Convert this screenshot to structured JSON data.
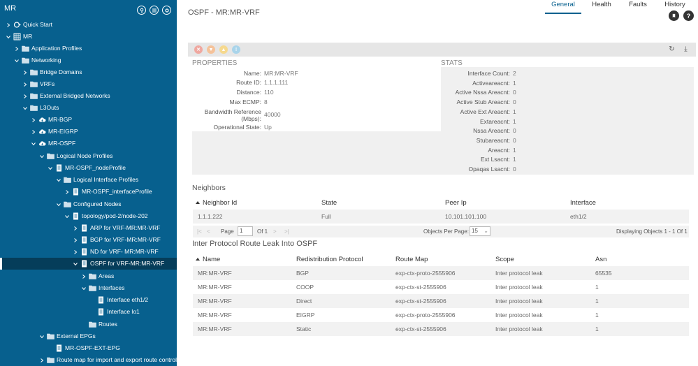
{
  "sidebar": {
    "title": "MR",
    "header_icons": [
      "map-pin-icon",
      "list-icon",
      "settings-icon"
    ],
    "tree": [
      {
        "label": "Quick Start",
        "icon": "quickstart-icon",
        "level": 0,
        "chev": "right"
      },
      {
        "label": "MR",
        "icon": "tenant-icon",
        "level": 0,
        "chev": "down"
      },
      {
        "label": "Application Profiles",
        "icon": "folder-icon",
        "level": 1,
        "chev": "right"
      },
      {
        "label": "Networking",
        "icon": "folder-icon",
        "level": 1,
        "chev": "down"
      },
      {
        "label": "Bridge Domains",
        "icon": "folder-icon",
        "level": 2,
        "chev": "right"
      },
      {
        "label": "VRFs",
        "icon": "folder-icon",
        "level": 2,
        "chev": "right"
      },
      {
        "label": "External Bridged Networks",
        "icon": "folder-icon",
        "level": 2,
        "chev": "right"
      },
      {
        "label": "L3Outs",
        "icon": "folder-icon",
        "level": 2,
        "chev": "down"
      },
      {
        "label": "MR-BGP",
        "icon": "cloud-icon",
        "level": 3,
        "chev": "right"
      },
      {
        "label": "MR-EIGRP",
        "icon": "cloud-icon",
        "level": 3,
        "chev": "right"
      },
      {
        "label": "MR-OSPF",
        "icon": "cloud-icon",
        "level": 3,
        "chev": "down"
      },
      {
        "label": "Logical Node Profiles",
        "icon": "folder-icon",
        "level": 4,
        "chev": "down"
      },
      {
        "label": "MR-OSPF_nodeProfile",
        "icon": "doc-icon",
        "level": 5,
        "chev": "down"
      },
      {
        "label": "Logical Interface Profiles",
        "icon": "folder-icon",
        "level": 6,
        "chev": "down"
      },
      {
        "label": "MR-OSPF_interfaceProfile",
        "icon": "doc-icon",
        "level": 7,
        "chev": "right"
      },
      {
        "label": "Configured Nodes",
        "icon": "folder-icon",
        "level": 6,
        "chev": "down"
      },
      {
        "label": "topology/pod-2/node-202",
        "icon": "doc-icon",
        "level": 7,
        "chev": "down"
      },
      {
        "label": "ARP for VRF-MR:MR-VRF",
        "icon": "doc-icon",
        "level": 8,
        "chev": "right"
      },
      {
        "label": "BGP for VRF-MR:MR-VRF",
        "icon": "doc-icon",
        "level": 8,
        "chev": "right"
      },
      {
        "label": "ND for VRF- MR:MR-VRF",
        "icon": "doc-icon",
        "level": 8,
        "chev": "right"
      },
      {
        "label": "OSPF for VRF-MR:MR-VRF",
        "icon": "doc-icon",
        "level": 8,
        "chev": "down",
        "selected": true
      },
      {
        "label": "Areas",
        "icon": "folder-icon",
        "level": 9,
        "chev": "right"
      },
      {
        "label": "Interfaces",
        "icon": "folder-icon",
        "level": 9,
        "chev": "down"
      },
      {
        "label": "Interface eth1/2",
        "icon": "doc-icon",
        "level": 10,
        "chev": ""
      },
      {
        "label": "Interface lo1",
        "icon": "doc-icon",
        "level": 10,
        "chev": ""
      },
      {
        "label": "Routes",
        "icon": "folder-icon",
        "level": 9,
        "chev": ""
      },
      {
        "label": "External EPGs",
        "icon": "folder-icon",
        "level": 4,
        "chev": "down"
      },
      {
        "label": "MR-OSPF-EXT-EPG",
        "icon": "doc-icon",
        "level": 5,
        "chev": ""
      },
      {
        "label": "Route map for import and export route control",
        "icon": "folder-icon",
        "level": 4,
        "chev": "right"
      }
    ]
  },
  "header": {
    "title": "OSPF - MR:MR-VRF",
    "icons": [
      "bookmark-icon",
      "help-icon"
    ],
    "help_glyph": "?"
  },
  "tabs": [
    {
      "label": "General",
      "active": true
    },
    {
      "label": "Health",
      "active": false
    },
    {
      "label": "Faults",
      "active": false
    },
    {
      "label": "History",
      "active": false
    }
  ],
  "toolbar": {
    "status_icons": [
      {
        "name": "critical-fault-icon",
        "color": "#f0a8a0",
        "glyph": "✕"
      },
      {
        "name": "major-fault-icon",
        "color": "#f5c29a",
        "glyph": "▼"
      },
      {
        "name": "minor-fault-icon",
        "color": "#f6d98e",
        "glyph": "▲"
      },
      {
        "name": "warning-fault-icon",
        "color": "#a9d4ea",
        "glyph": "!"
      }
    ],
    "right_icons": [
      {
        "name": "refresh-icon",
        "glyph": "↻"
      },
      {
        "name": "download-icon",
        "glyph": "⤓"
      }
    ]
  },
  "properties": {
    "heading": "PROPERTIES",
    "rows": [
      {
        "label": "Name:",
        "value": "MR:MR-VRF"
      },
      {
        "label": "Route ID:",
        "value": "1.1.1.111"
      },
      {
        "label": "Distance:",
        "value": "110"
      },
      {
        "label": "Max ECMP:",
        "value": "8"
      },
      {
        "label": "Bandwidth Reference (Mbps):",
        "value": "40000"
      },
      {
        "label": "Operational State:",
        "value": "Up"
      }
    ]
  },
  "stats": {
    "heading": "STATS",
    "rows": [
      {
        "label": "Interface Count:",
        "value": "2"
      },
      {
        "label": "Activeareacnt:",
        "value": "1"
      },
      {
        "label": "Active Nssa Areacnt:",
        "value": "0"
      },
      {
        "label": "Active Stub Areacnt:",
        "value": "0"
      },
      {
        "label": "Active Ext Areacnt:",
        "value": "1"
      },
      {
        "label": "Extareacnt:",
        "value": "1"
      },
      {
        "label": "Nssa Areacnt:",
        "value": "0"
      },
      {
        "label": "Stubareacnt:",
        "value": "0"
      },
      {
        "label": "Areacnt:",
        "value": "1"
      },
      {
        "label": "Ext Lsacnt:",
        "value": "1"
      },
      {
        "label": "Opaqas Lsacnt:",
        "value": "0"
      }
    ]
  },
  "neighbors": {
    "heading": "Neighbors",
    "columns": [
      "Neighbor Id",
      "State",
      "Peer Ip",
      "Interface"
    ],
    "rows": [
      [
        "1.1.1.222",
        "Full",
        "10.101.101.100",
        "eth1/2"
      ]
    ],
    "pager": {
      "page_label": "Page",
      "page_value": "1",
      "of_label": "Of 1",
      "per_page_label": "Objects Per Page:",
      "per_page_value": "15",
      "displaying": "Displaying Objects 1 - 1 Of 1"
    }
  },
  "leak": {
    "heading": "Inter Protocol Route Leak Into OSPF",
    "columns": [
      "Name",
      "Redistribution Protocol",
      "Route Map",
      "Scope",
      "Asn"
    ],
    "rows": [
      [
        "MR:MR-VRF",
        "BGP",
        "exp-ctx-proto-2555906",
        "Inter protocol leak",
        "65535"
      ],
      [
        "MR:MR-VRF",
        "COOP",
        "exp-ctx-st-2555906",
        "Inter protocol leak",
        "1"
      ],
      [
        "MR:MR-VRF",
        "Direct",
        "exp-ctx-st-2555906",
        "Inter protocol leak",
        "1"
      ],
      [
        "MR:MR-VRF",
        "EIGRP",
        "exp-ctx-proto-2555906",
        "Inter protocol leak",
        "1"
      ],
      [
        "MR:MR-VRF",
        "Static",
        "exp-ctx-st-2555906",
        "Inter protocol leak",
        "1"
      ]
    ]
  }
}
